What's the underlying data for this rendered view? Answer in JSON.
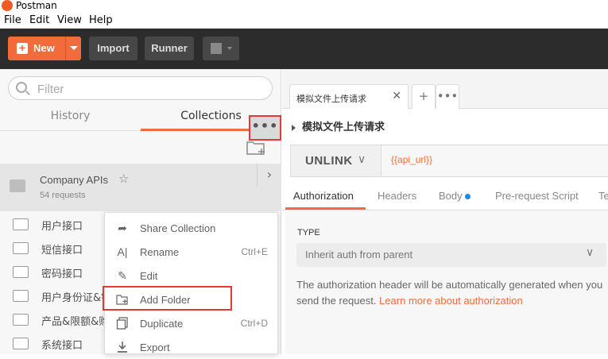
{
  "app": {
    "title": "Postman"
  },
  "menubar": {
    "items": [
      "File",
      "Edit",
      "View",
      "Help"
    ]
  },
  "toolbar": {
    "new_label": "New",
    "import_label": "Import",
    "runner_label": "Runner"
  },
  "sidebar": {
    "filter_placeholder": "Filter",
    "tabs": {
      "history": "History",
      "collections": "Collections"
    },
    "collection": {
      "name": "Company APIs",
      "count": "54 requests"
    },
    "folders": [
      "用户接口",
      "短信接口",
      "密码接口",
      "用户身份证&银",
      "产品&限额&购",
      "系统接口"
    ]
  },
  "context_menu": {
    "items": [
      {
        "icon": "share-icon",
        "label": "Share Collection",
        "shortcut": ""
      },
      {
        "icon": "rename-icon",
        "label": "Rename",
        "shortcut": "Ctrl+E"
      },
      {
        "icon": "edit-icon",
        "label": "Edit",
        "shortcut": ""
      },
      {
        "icon": "add-folder-icon",
        "label": "Add Folder",
        "shortcut": ""
      },
      {
        "icon": "duplicate-icon",
        "label": "Duplicate",
        "shortcut": "Ctrl+D"
      },
      {
        "icon": "export-icon",
        "label": "Export",
        "shortcut": ""
      }
    ]
  },
  "request": {
    "tab_title": "模拟文件上传请求",
    "title": "模拟文件上传请求",
    "method": "UNLINK",
    "url": "{{api_url}}",
    "subtabs": [
      "Authorization",
      "Headers",
      "Body",
      "Pre-request Script",
      "Te"
    ],
    "auth": {
      "type_label": "TYPE",
      "type_value": "Inherit auth from parent",
      "description": "The authorization header will be automatically generated when you send the request. ",
      "link": "Learn more about authorization"
    }
  },
  "colors": {
    "accent": "#f26b3a",
    "highlight": "#e53935",
    "body_dot": "#1e88e5"
  }
}
